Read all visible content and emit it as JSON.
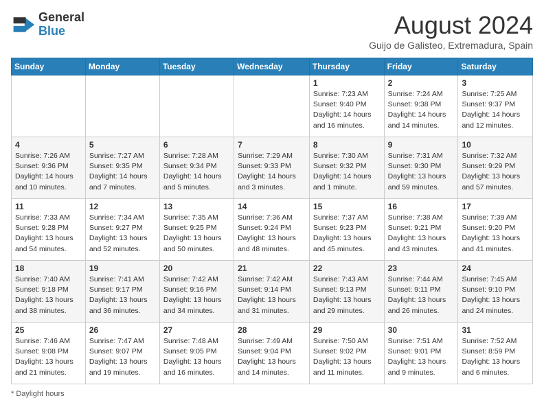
{
  "header": {
    "logo_text_general": "General",
    "logo_text_blue": "Blue",
    "month_title": "August 2024",
    "location": "Guijo de Galisteo, Extremadura, Spain"
  },
  "days_of_week": [
    "Sunday",
    "Monday",
    "Tuesday",
    "Wednesday",
    "Thursday",
    "Friday",
    "Saturday"
  ],
  "weeks": [
    [
      {
        "day": "",
        "info": ""
      },
      {
        "day": "",
        "info": ""
      },
      {
        "day": "",
        "info": ""
      },
      {
        "day": "",
        "info": ""
      },
      {
        "day": "1",
        "info": "Sunrise: 7:23 AM\nSunset: 9:40 PM\nDaylight: 14 hours and 16 minutes."
      },
      {
        "day": "2",
        "info": "Sunrise: 7:24 AM\nSunset: 9:38 PM\nDaylight: 14 hours and 14 minutes."
      },
      {
        "day": "3",
        "info": "Sunrise: 7:25 AM\nSunset: 9:37 PM\nDaylight: 14 hours and 12 minutes."
      }
    ],
    [
      {
        "day": "4",
        "info": "Sunrise: 7:26 AM\nSunset: 9:36 PM\nDaylight: 14 hours and 10 minutes."
      },
      {
        "day": "5",
        "info": "Sunrise: 7:27 AM\nSunset: 9:35 PM\nDaylight: 14 hours and 7 minutes."
      },
      {
        "day": "6",
        "info": "Sunrise: 7:28 AM\nSunset: 9:34 PM\nDaylight: 14 hours and 5 minutes."
      },
      {
        "day": "7",
        "info": "Sunrise: 7:29 AM\nSunset: 9:33 PM\nDaylight: 14 hours and 3 minutes."
      },
      {
        "day": "8",
        "info": "Sunrise: 7:30 AM\nSunset: 9:32 PM\nDaylight: 14 hours and 1 minute."
      },
      {
        "day": "9",
        "info": "Sunrise: 7:31 AM\nSunset: 9:30 PM\nDaylight: 13 hours and 59 minutes."
      },
      {
        "day": "10",
        "info": "Sunrise: 7:32 AM\nSunset: 9:29 PM\nDaylight: 13 hours and 57 minutes."
      }
    ],
    [
      {
        "day": "11",
        "info": "Sunrise: 7:33 AM\nSunset: 9:28 PM\nDaylight: 13 hours and 54 minutes."
      },
      {
        "day": "12",
        "info": "Sunrise: 7:34 AM\nSunset: 9:27 PM\nDaylight: 13 hours and 52 minutes."
      },
      {
        "day": "13",
        "info": "Sunrise: 7:35 AM\nSunset: 9:25 PM\nDaylight: 13 hours and 50 minutes."
      },
      {
        "day": "14",
        "info": "Sunrise: 7:36 AM\nSunset: 9:24 PM\nDaylight: 13 hours and 48 minutes."
      },
      {
        "day": "15",
        "info": "Sunrise: 7:37 AM\nSunset: 9:23 PM\nDaylight: 13 hours and 45 minutes."
      },
      {
        "day": "16",
        "info": "Sunrise: 7:38 AM\nSunset: 9:21 PM\nDaylight: 13 hours and 43 minutes."
      },
      {
        "day": "17",
        "info": "Sunrise: 7:39 AM\nSunset: 9:20 PM\nDaylight: 13 hours and 41 minutes."
      }
    ],
    [
      {
        "day": "18",
        "info": "Sunrise: 7:40 AM\nSunset: 9:18 PM\nDaylight: 13 hours and 38 minutes."
      },
      {
        "day": "19",
        "info": "Sunrise: 7:41 AM\nSunset: 9:17 PM\nDaylight: 13 hours and 36 minutes."
      },
      {
        "day": "20",
        "info": "Sunrise: 7:42 AM\nSunset: 9:16 PM\nDaylight: 13 hours and 34 minutes."
      },
      {
        "day": "21",
        "info": "Sunrise: 7:42 AM\nSunset: 9:14 PM\nDaylight: 13 hours and 31 minutes."
      },
      {
        "day": "22",
        "info": "Sunrise: 7:43 AM\nSunset: 9:13 PM\nDaylight: 13 hours and 29 minutes."
      },
      {
        "day": "23",
        "info": "Sunrise: 7:44 AM\nSunset: 9:11 PM\nDaylight: 13 hours and 26 minutes."
      },
      {
        "day": "24",
        "info": "Sunrise: 7:45 AM\nSunset: 9:10 PM\nDaylight: 13 hours and 24 minutes."
      }
    ],
    [
      {
        "day": "25",
        "info": "Sunrise: 7:46 AM\nSunset: 9:08 PM\nDaylight: 13 hours and 21 minutes."
      },
      {
        "day": "26",
        "info": "Sunrise: 7:47 AM\nSunset: 9:07 PM\nDaylight: 13 hours and 19 minutes."
      },
      {
        "day": "27",
        "info": "Sunrise: 7:48 AM\nSunset: 9:05 PM\nDaylight: 13 hours and 16 minutes."
      },
      {
        "day": "28",
        "info": "Sunrise: 7:49 AM\nSunset: 9:04 PM\nDaylight: 13 hours and 14 minutes."
      },
      {
        "day": "29",
        "info": "Sunrise: 7:50 AM\nSunset: 9:02 PM\nDaylight: 13 hours and 11 minutes."
      },
      {
        "day": "30",
        "info": "Sunrise: 7:51 AM\nSunset: 9:01 PM\nDaylight: 13 hours and 9 minutes."
      },
      {
        "day": "31",
        "info": "Sunrise: 7:52 AM\nSunset: 8:59 PM\nDaylight: 13 hours and 6 minutes."
      }
    ]
  ],
  "footnote": "Daylight hours"
}
